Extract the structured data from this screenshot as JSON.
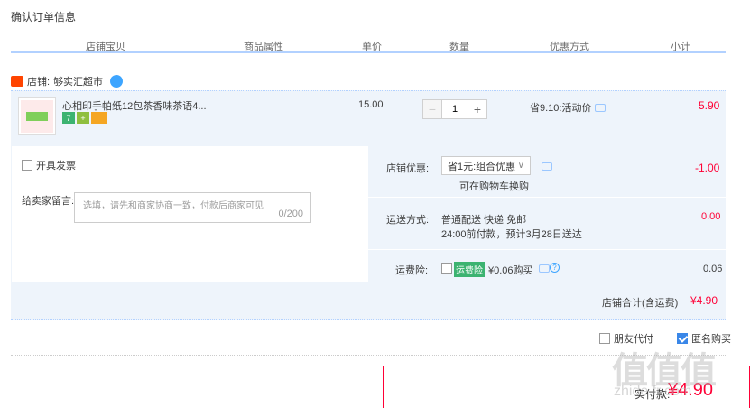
{
  "page": {
    "title": "确认订单信息"
  },
  "columns": [
    "店铺宝贝",
    "商品属性",
    "单价",
    "数量",
    "优惠方式",
    "小计"
  ],
  "shop": {
    "label": "店铺:",
    "name": "够实汇超市"
  },
  "item": {
    "name": "心相印手帕纸12包茶香味茶语4...",
    "price": "15.00",
    "quantity": "1",
    "minus": "−",
    "plus": "+",
    "discount": "省9.10:活动价",
    "subtotal": "5.90",
    "badges": [
      "7",
      "+",
      ""
    ]
  },
  "invoice": {
    "label": "开具发票"
  },
  "message": {
    "label": "给卖家留言:",
    "placeholder": "选填，请先和商家协商一致，付款后商家可见",
    "count": "0/200"
  },
  "shop_discount": {
    "label": "店铺优惠:",
    "selected": "省1元:组合优惠",
    "chevron": "∨",
    "note": "可在购物车换购",
    "value": "-1.00"
  },
  "shipping": {
    "label": "运送方式:",
    "method": "普通配送 快递 免邮",
    "eta": "24:00前付款，预计3月28日送达",
    "value": "0.00"
  },
  "insurance": {
    "label": "运费险:",
    "tag": "运费险",
    "price": "¥0.06购买",
    "value": "0.06"
  },
  "total": {
    "label": "店铺合计(含运费)",
    "value": "¥4.90"
  },
  "options": {
    "friend_pay": "朋友代付",
    "anonymous": "匿名购买"
  },
  "payment": {
    "label": "实付款:",
    "value": "¥4.90"
  },
  "watermark": {
    "main": "值值值",
    "sub": "zhide.fr.com"
  },
  "colors": {
    "accent": "#ff0036",
    "header_line": "#b2d1ff",
    "panel_bg": "#eef4fb"
  }
}
